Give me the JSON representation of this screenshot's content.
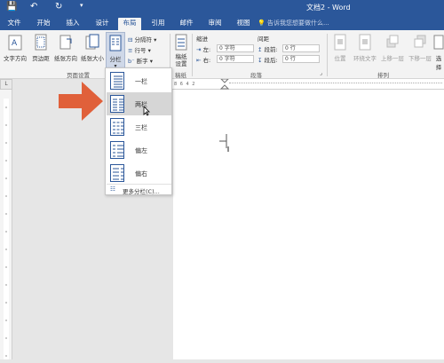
{
  "title": "文档2 - Word",
  "quick_access": {
    "save": "💾",
    "undo": "↶",
    "redo": "↻",
    "more": "▾"
  },
  "tabs": [
    {
      "label": "文件",
      "active": false
    },
    {
      "label": "开始",
      "active": false
    },
    {
      "label": "插入",
      "active": false
    },
    {
      "label": "设计",
      "active": false
    },
    {
      "label": "布局",
      "active": true
    },
    {
      "label": "引用",
      "active": false
    },
    {
      "label": "邮件",
      "active": false
    },
    {
      "label": "审阅",
      "active": false
    },
    {
      "label": "视图",
      "active": false
    }
  ],
  "tell_me": "告诉我您想要做什么...",
  "ribbon": {
    "text_direction": "文字方向",
    "margins": "页边距",
    "orientation": "纸张方向",
    "size": "纸张大小",
    "columns": "分栏",
    "breaks": "分隔符",
    "line_numbers": "行号",
    "hyphenation": "断字",
    "page_setup_label": "页面设置",
    "draft": "稿纸\n设置",
    "draft_label": "稿纸",
    "indent_label": "缩进",
    "spacing_label": "间距",
    "left_label": "左:",
    "right_label": "右:",
    "left_value": "0 字符",
    "right_value": "0 字符",
    "before_label": "段前:",
    "after_label": "段后:",
    "before_value": "0 行",
    "after_value": "0 行",
    "paragraph_label": "段落",
    "position": "位置",
    "wrap_text": "环绕文字",
    "bring_forward": "上移一层",
    "send_backward": "下移一层",
    "selection_pane": "选择",
    "arrange_label": "排列"
  },
  "ruler": {
    "ticks": "8  6  4  2"
  },
  "columns_menu": {
    "items": [
      "一栏",
      "两栏",
      "三栏",
      "偏左",
      "偏右"
    ],
    "highlighted": 1,
    "more": "更多分栏(C)..."
  },
  "colors": {
    "brand": "#2b579a",
    "arrow": "#e0603a"
  }
}
